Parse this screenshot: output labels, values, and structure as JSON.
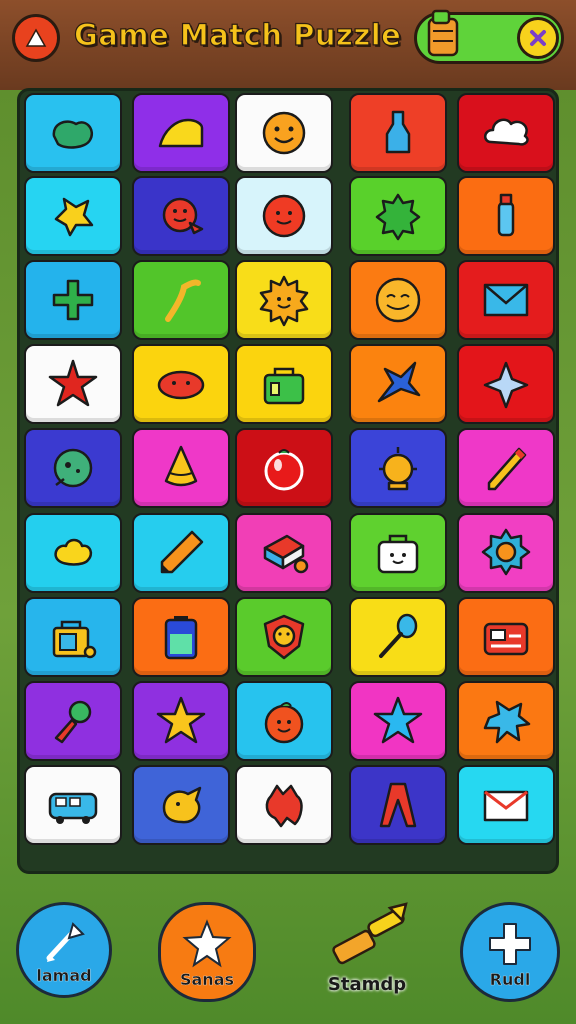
{
  "header": {
    "title": "Game Match Puzzle"
  },
  "board": {
    "rows": [
      [
        {
          "bg": "#29c1ef",
          "icon": "green-blob-icon"
        },
        {
          "bg": "#8f2fe8",
          "icon": "yellow-wedge-icon"
        },
        {
          "bg": "#fbfbfb",
          "icon": "smiley-icon"
        },
        {
          "bg": "#ee3f27",
          "icon": "bottle-icon"
        },
        {
          "bg": "#d9101c",
          "icon": "cloud-icon"
        }
      ],
      [
        {
          "bg": "#26d4f2",
          "icon": "yellow-splat-icon"
        },
        {
          "bg": "#3a34c9",
          "icon": "red-fish-icon"
        },
        {
          "bg": "#d7f4fb",
          "icon": "red-ball-icon"
        },
        {
          "bg": "#59d12b",
          "icon": "green-gear-icon"
        },
        {
          "bg": "#fb6d12",
          "icon": "tube-icon"
        }
      ],
      [
        {
          "bg": "#24b3ec",
          "icon": "green-cross-icon"
        },
        {
          "bg": "#52c52a",
          "icon": "branch-icon"
        },
        {
          "bg": "#f8dd19",
          "icon": "sun-face-icon"
        },
        {
          "bg": "#fb7b12",
          "icon": "orange-face-icon"
        },
        {
          "bg": "#e41c1d",
          "icon": "envelope-icon"
        }
      ],
      [
        {
          "bg": "#fbfbfb",
          "icon": "red-starfish-icon"
        },
        {
          "bg": "#fbd40e",
          "icon": "red-bean-icon"
        },
        {
          "bg": "#fbd40e",
          "icon": "bag-icon"
        },
        {
          "bg": "#fb830f",
          "icon": "blue-star-icon"
        },
        {
          "bg": "#e3151a",
          "icon": "compass-star-icon"
        }
      ],
      [
        {
          "bg": "#3b3ad0",
          "icon": "green-shell-icon"
        },
        {
          "bg": "#ef38c8",
          "icon": "yellow-cone-icon"
        },
        {
          "bg": "#cc0f16",
          "icon": "tomato-icon"
        },
        {
          "bg": "#3b44d8",
          "icon": "lamp-icon"
        },
        {
          "bg": "#ef38c8",
          "icon": "pencil-cone-icon"
        }
      ],
      [
        {
          "bg": "#24cfee",
          "icon": "yellow-cloud-icon"
        },
        {
          "bg": "#26cdee",
          "icon": "crayon-icon"
        },
        {
          "bg": "#f13fb6",
          "icon": "cake-icon"
        },
        {
          "bg": "#5fd12f",
          "icon": "suitcase-icon"
        },
        {
          "bg": "#f13fc3",
          "icon": "flower-gear-icon"
        }
      ],
      [
        {
          "bg": "#27b5ec",
          "icon": "lock-bag-icon"
        },
        {
          "bg": "#fb6d14",
          "icon": "battery-icon"
        },
        {
          "bg": "#5acb2c",
          "icon": "shield-face-icon"
        },
        {
          "bg": "#f8dd17",
          "icon": "spoon-icon"
        },
        {
          "bg": "#fb6d14",
          "icon": "radio-icon"
        }
      ],
      [
        {
          "bg": "#8f30e0",
          "icon": "racket-icon"
        },
        {
          "bg": "#8f30e0",
          "icon": "gold-star-icon"
        },
        {
          "bg": "#27c3ee",
          "icon": "orange-fruit-icon"
        },
        {
          "bg": "#f135c3",
          "icon": "cyan-star-icon"
        },
        {
          "bg": "#fb7812",
          "icon": "blue-splat-icon"
        }
      ],
      [
        {
          "bg": "#fbfbfb",
          "icon": "bus-icon"
        },
        {
          "bg": "#3f64d8",
          "icon": "dragon-icon"
        },
        {
          "bg": "#fbfbfb",
          "icon": "red-monster-icon"
        },
        {
          "bg": "#3c35c8",
          "icon": "red-tongs-icon"
        },
        {
          "bg": "#26d8f1",
          "icon": "mail-icon"
        }
      ]
    ]
  },
  "bottom_bar": {
    "buttons": [
      {
        "label": "lamad",
        "icon": "wand-icon",
        "color": "#2aa8e8"
      },
      {
        "label": "Sanas",
        "icon": "star-icon",
        "color": "#f77b12"
      },
      {
        "label": "Stamdp",
        "icon": "hammer-icon",
        "color": "transparent"
      },
      {
        "label": "Rudl",
        "icon": "plus-star-icon",
        "color": "#2aa8e8"
      }
    ]
  }
}
